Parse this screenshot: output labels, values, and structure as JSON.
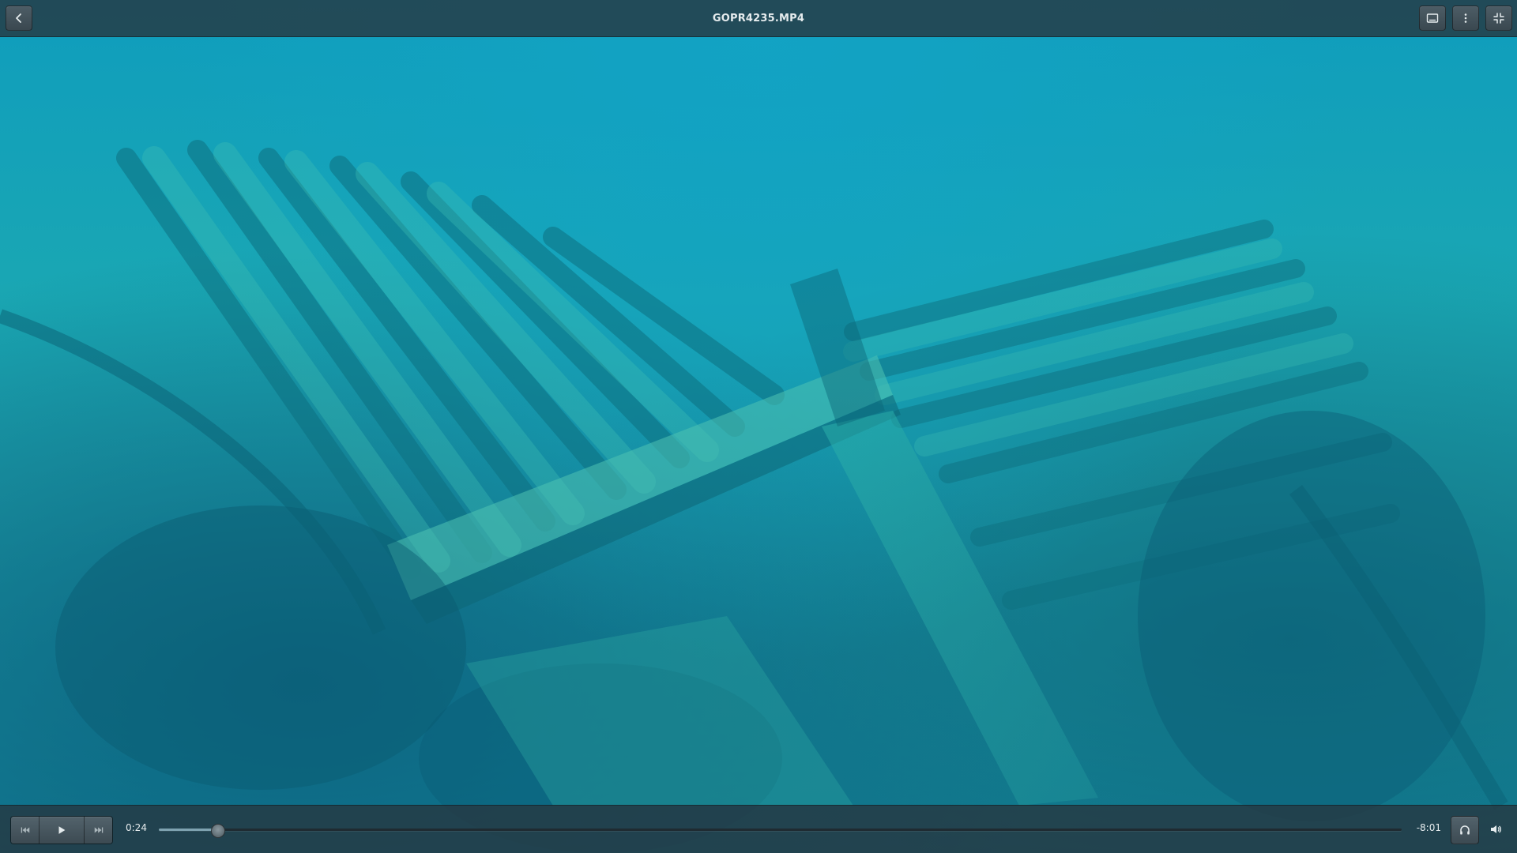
{
  "window": {
    "title": "GOPR4235.MP4"
  },
  "header": {
    "back_icon": "chevron-left-icon",
    "subtitles_icon": "subtitles-icon",
    "menu_icon": "vertical-ellipsis-icon",
    "fullscreen_icon": "exit-fullscreen-icon"
  },
  "video": {
    "scene": "underwater shipwreck"
  },
  "controls": {
    "elapsed": "0:24",
    "remaining": "-8:01",
    "progress_fraction": 0.047,
    "prev_icon": "skip-back-icon",
    "play_icon": "play-icon",
    "next_icon": "skip-forward-icon",
    "audio_track_icon": "headphones-icon",
    "volume_icon": "speaker-icon"
  },
  "colors": {
    "bar_background": "#263842",
    "icon": "#e6ecee",
    "water": "#1aa7b3"
  }
}
